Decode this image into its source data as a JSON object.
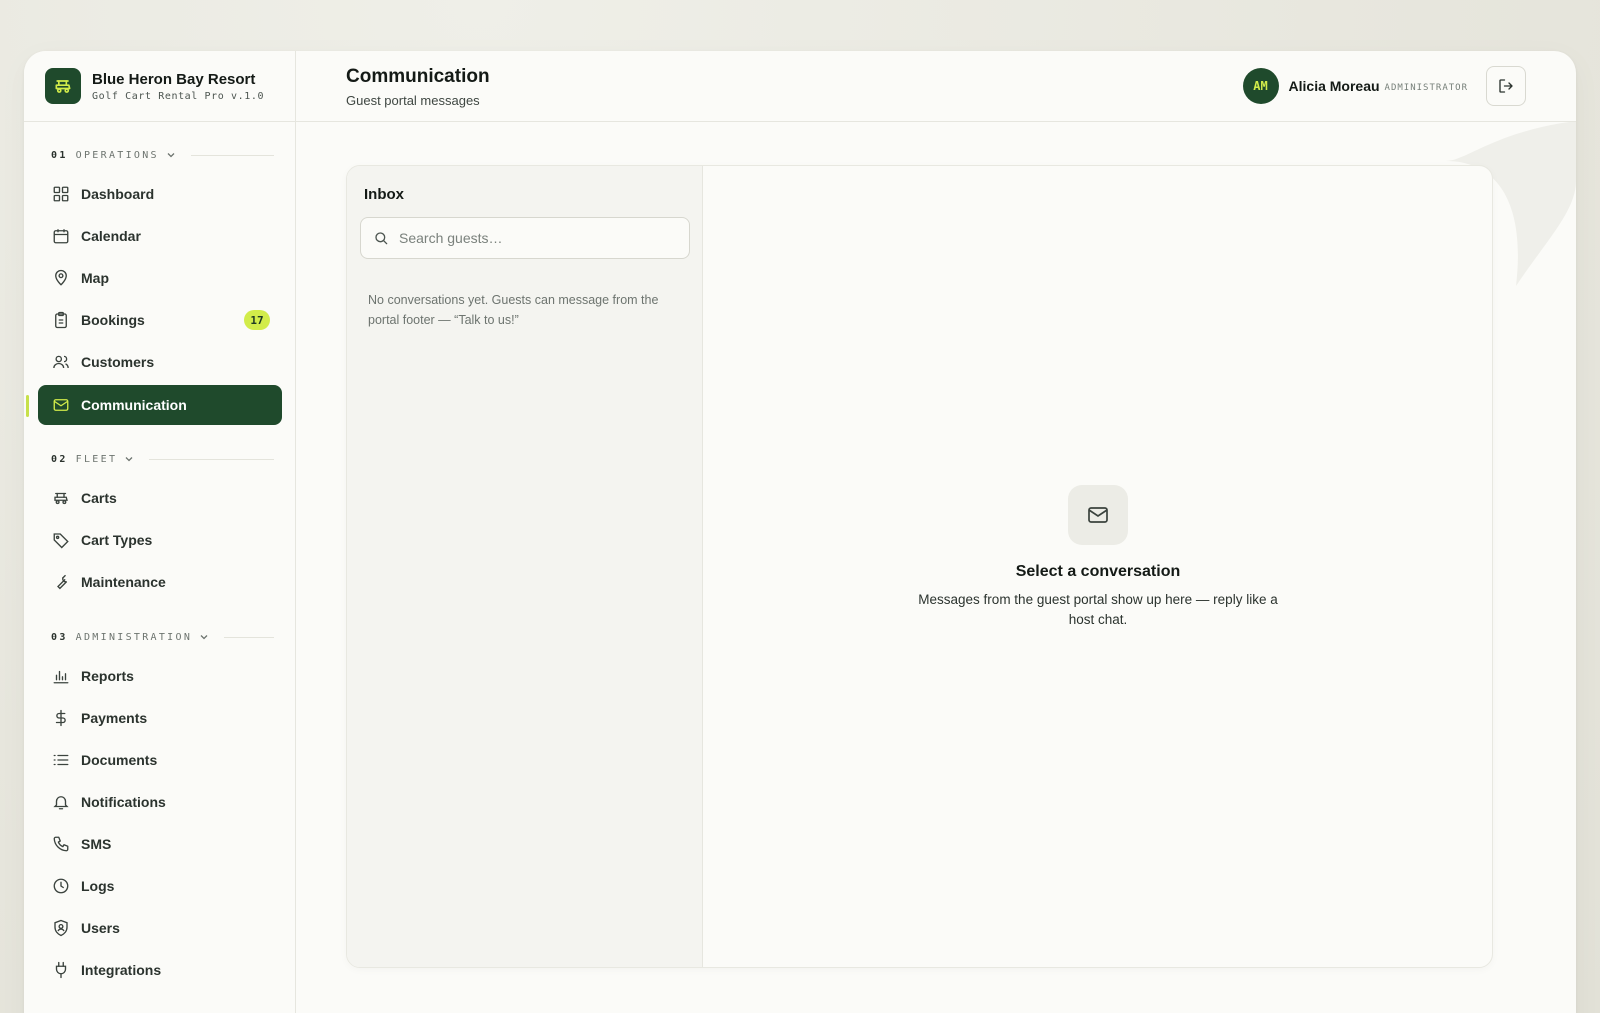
{
  "brand": {
    "name": "Blue Heron Bay Resort",
    "subtitle": "Golf Cart Rental Pro v.1.0",
    "logo_icon": "golf-cart-icon"
  },
  "sections": [
    {
      "num": "01",
      "label": "OPERATIONS"
    },
    {
      "num": "02",
      "label": "FLEET"
    },
    {
      "num": "03",
      "label": "ADMINISTRATION"
    }
  ],
  "nav": {
    "dashboard": {
      "label": "Dashboard",
      "icon": "grid-icon"
    },
    "calendar": {
      "label": "Calendar",
      "icon": "calendar-icon"
    },
    "map": {
      "label": "Map",
      "icon": "map-pin-icon"
    },
    "bookings": {
      "label": "Bookings",
      "icon": "clipboard-icon",
      "badge": "17"
    },
    "customers": {
      "label": "Customers",
      "icon": "users-icon"
    },
    "communication": {
      "label": "Communication",
      "icon": "mail-icon",
      "active": true
    },
    "carts": {
      "label": "Carts",
      "icon": "golf-cart-icon"
    },
    "cart_types": {
      "label": "Cart Types",
      "icon": "tag-icon"
    },
    "maintenance": {
      "label": "Maintenance",
      "icon": "wrench-icon"
    },
    "reports": {
      "label": "Reports",
      "icon": "bar-chart-icon"
    },
    "payments": {
      "label": "Payments",
      "icon": "dollar-icon"
    },
    "documents": {
      "label": "Documents",
      "icon": "list-icon"
    },
    "notifications": {
      "label": "Notifications",
      "icon": "bell-icon"
    },
    "sms": {
      "label": "SMS",
      "icon": "phone-icon"
    },
    "logs": {
      "label": "Logs",
      "icon": "clock-icon"
    },
    "users": {
      "label": "Users",
      "icon": "shield-user-icon"
    },
    "integrations": {
      "label": "Integrations",
      "icon": "plug-icon"
    }
  },
  "header": {
    "title": "Communication",
    "subtitle": "Guest portal messages"
  },
  "user": {
    "initials": "AM",
    "name": "Alicia Moreau",
    "role": "ADMINISTRATOR"
  },
  "inbox": {
    "title": "Inbox",
    "search_placeholder": "Search guests…",
    "empty_text": "No conversations yet. Guests can message from the portal footer — “Talk to us!”"
  },
  "conversation": {
    "empty_title": "Select a conversation",
    "empty_desc": "Messages from the guest portal show up here — reply like a host chat."
  },
  "colors": {
    "accent_dark": "#1f4a2c",
    "accent_lime": "#d2ec4a",
    "background": "#e9e8df",
    "surface": "#fbfbf8"
  }
}
